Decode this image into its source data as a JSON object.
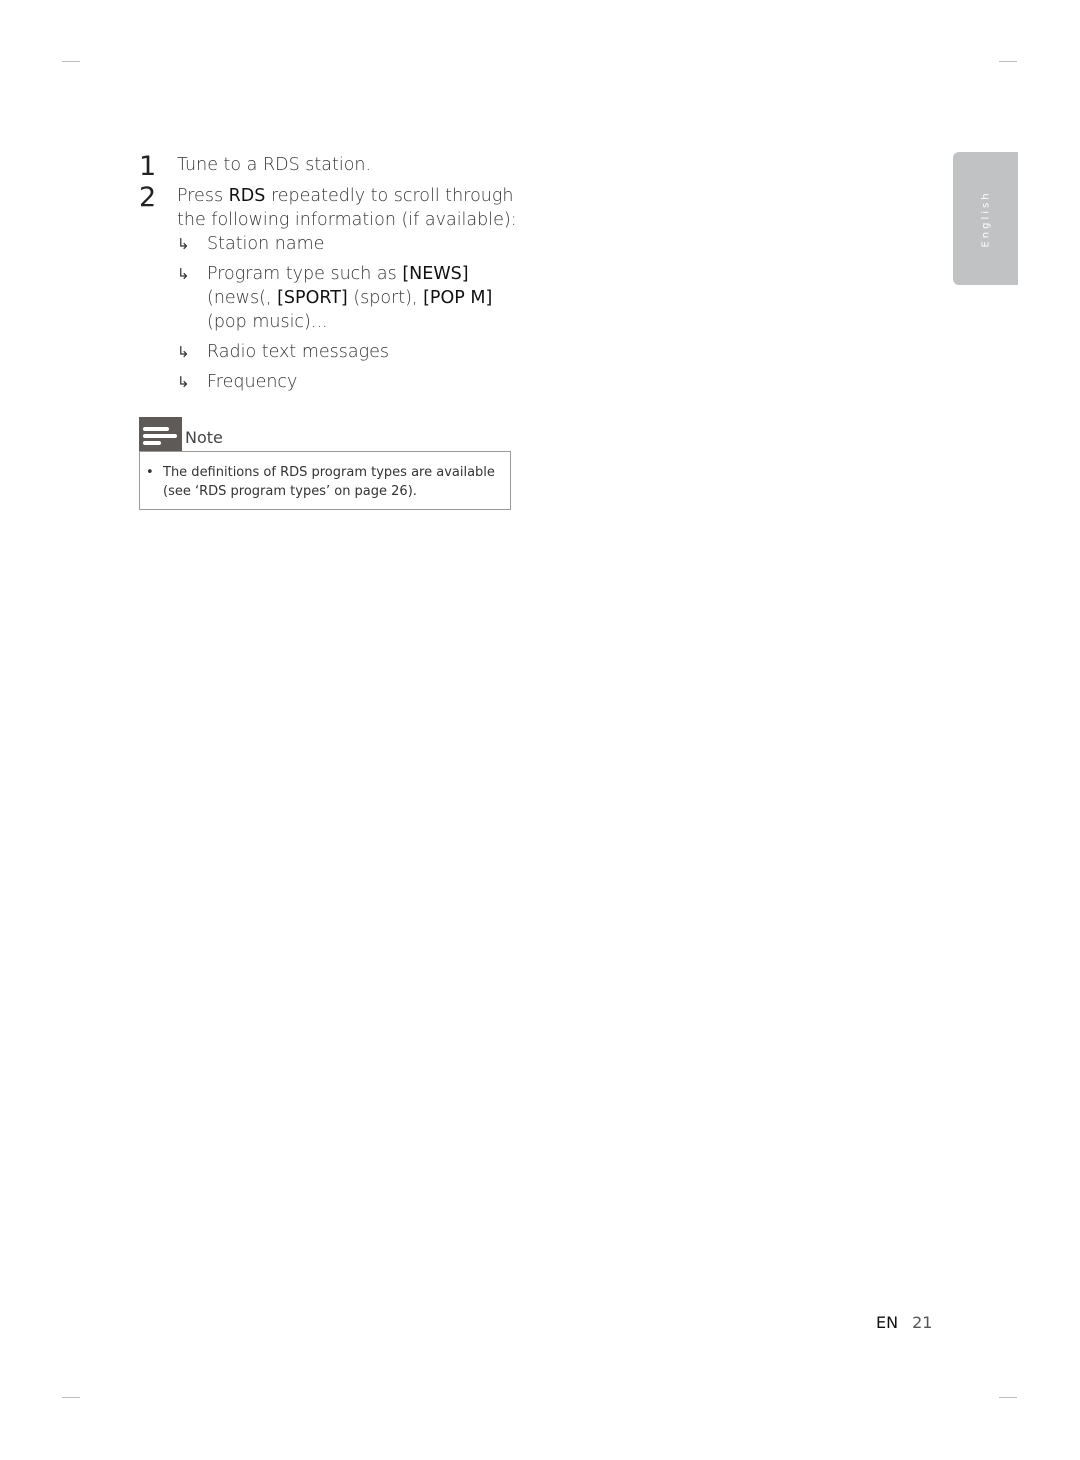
{
  "sidebar_tab": {
    "label": "English",
    "color": "#c1c2c4"
  },
  "steps": [
    {
      "number": "1",
      "text": "Tune to a RDS station."
    },
    {
      "number": "2",
      "text_pre": "Press ",
      "text_bold": "RDS",
      "text_post": " repeatedly to scroll through the following information (if available):",
      "results": [
        {
          "arrow": "↳",
          "text": "Station name"
        },
        {
          "arrow": "↳",
          "parts": [
            {
              "t": "Program type such as ",
              "b": false
            },
            {
              "t": "[NEWS]",
              "b": true
            },
            {
              "t": " (news(, ",
              "b": false
            },
            {
              "t": "[SPORT]",
              "b": true
            },
            {
              "t": " (sport), ",
              "b": false
            },
            {
              "t": "[POP M]",
              "b": true
            },
            {
              "t": " (pop music)...",
              "b": false
            }
          ]
        },
        {
          "arrow": "↳",
          "text": "Radio text messages"
        },
        {
          "arrow": "↳",
          "text": "Frequency"
        }
      ]
    }
  ],
  "note": {
    "title": "Note",
    "icon": "note-icon",
    "icon_color": "#5e5a58",
    "items": [
      {
        "bullet": "•",
        "text": "The definitions of RDS program types are available (see ‘RDS program types’ on page 26)."
      }
    ]
  },
  "footer": {
    "lang": "EN",
    "page": "21"
  }
}
